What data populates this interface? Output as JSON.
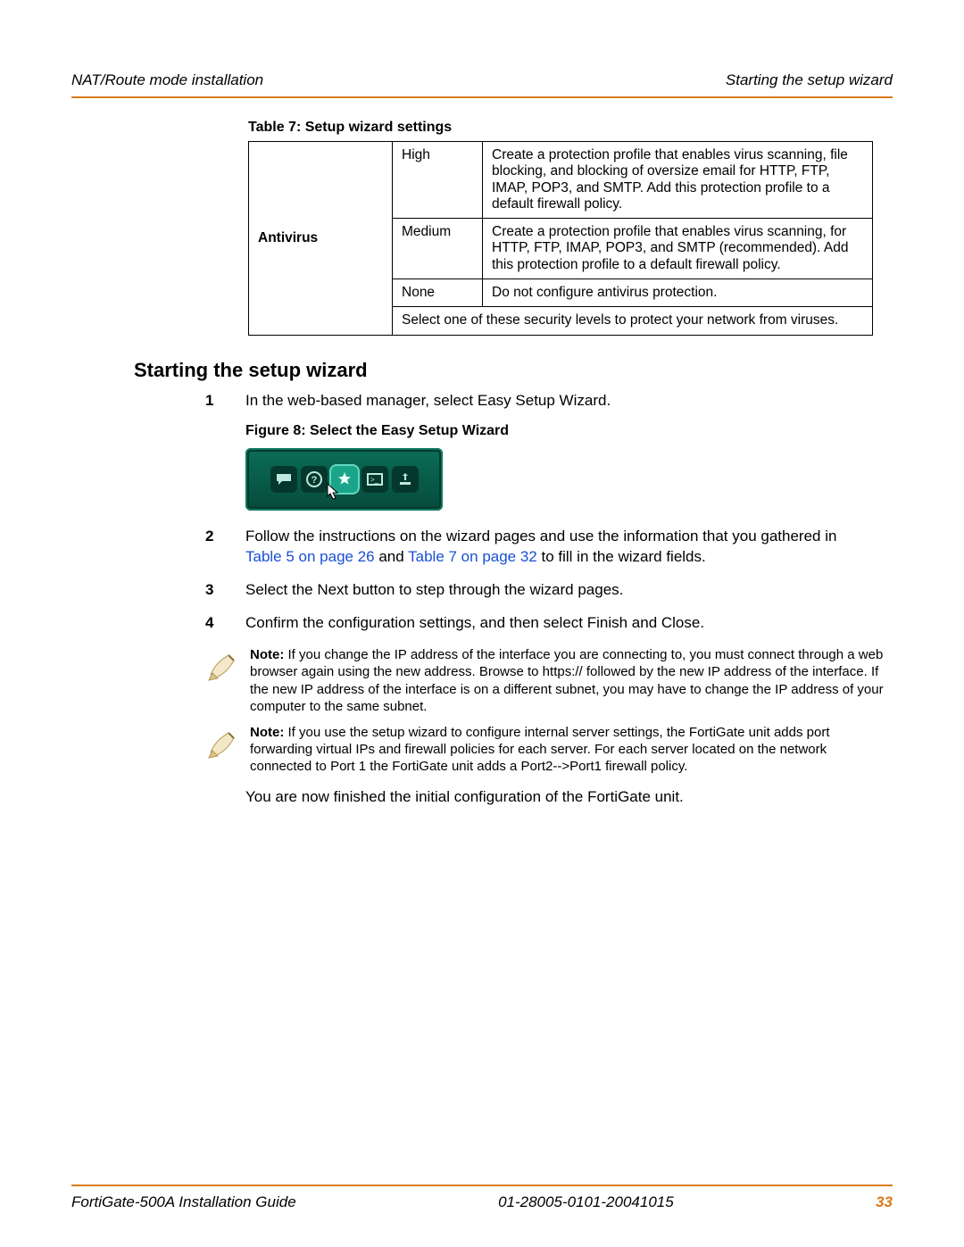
{
  "header": {
    "left": "NAT/Route mode installation",
    "right": "Starting the setup wizard"
  },
  "table": {
    "caption": "Table 7: Setup wizard settings",
    "rowHeader": "Antivirus",
    "rows": [
      {
        "level": "High",
        "desc": "Create a protection profile that enables virus scanning, file blocking, and blocking of oversize email for HTTP, FTP, IMAP, POP3, and SMTP. Add this protection profile to a default firewall policy."
      },
      {
        "level": "Medium",
        "desc": "Create a protection profile that enables virus scanning, for HTTP, FTP, IMAP, POP3, and SMTP (recommended). Add this protection profile to a default firewall policy."
      },
      {
        "level": "None",
        "desc": "Do not configure antivirus protection."
      }
    ],
    "footer": "Select one of these security levels to protect your network from viruses."
  },
  "sectionTitle": "Starting the setup wizard",
  "steps": {
    "s1": "In the web-based manager, select Easy Setup Wizard.",
    "s2a": "Follow the instructions on the wizard pages and use the information that you gathered in ",
    "s2link1": "Table 5 on page 26",
    "s2b": " and ",
    "s2link2": "Table 7 on page 32",
    "s2c": " to fill in the wizard fields.",
    "s3": "Select the Next button to step through the wizard pages.",
    "s4": "Confirm the configuration settings, and then select Finish and Close."
  },
  "figCaption": "Figure 8:  Select the Easy Setup Wizard",
  "toolbarIcons": {
    "chat": "chat-icon",
    "help": "help-icon",
    "wizard": "wizard-icon",
    "console": "console-icon",
    "update": "update-icon"
  },
  "notes": {
    "n1label": "Note:",
    "n1": "  If you change the IP address of the interface you are connecting to, you must connect through a web browser again using the new address. Browse to https:// followed by the new IP address of the interface. If the new IP address of the interface is on a different subnet, you may have to change the IP address of your computer to the same subnet.",
    "n2label": "Note:",
    "n2": " If you use the setup wizard to configure internal server settings, the FortiGate unit adds port forwarding virtual IPs and firewall policies for each server. For each server located on the network connected to Port 1 the FortiGate unit adds a Port2-->Port1 firewall policy."
  },
  "closing": "You are now finished the initial configuration of the FortiGate unit.",
  "footer": {
    "left": "FortiGate-500A Installation Guide",
    "center": "01-28005-0101-20041015",
    "page": "33"
  }
}
